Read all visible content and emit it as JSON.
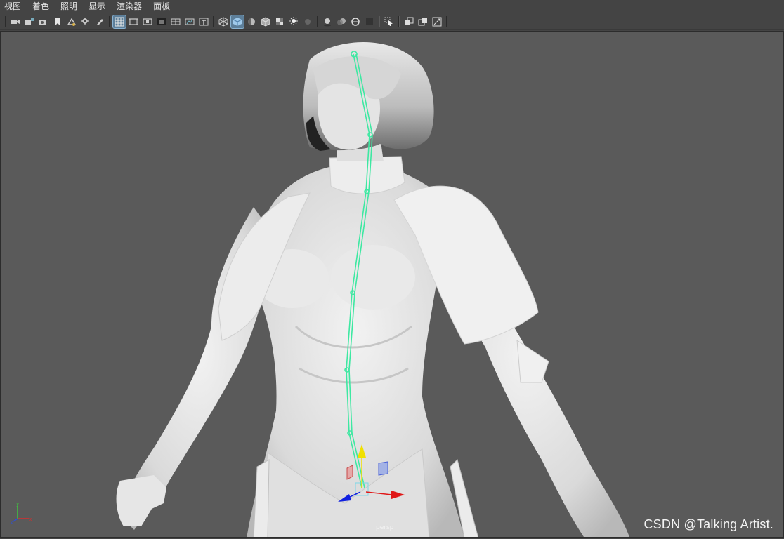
{
  "menubar": {
    "items": [
      "视图",
      "着色",
      "照明",
      "显示",
      "渲染器",
      "面板"
    ]
  },
  "toolbar": {
    "groups": [
      [
        "camera-icon",
        "camera-attributes-icon",
        "camera-lock-icon",
        "bookmark-icon",
        "image-plane-icon",
        "pan-zoom-icon",
        "grease-pencil-icon"
      ],
      [
        "grid-icon",
        "film-gate-icon",
        "resolution-gate-icon",
        "gate-mask-icon",
        "field-chart-icon",
        "safe-action-icon",
        "safe-title-icon"
      ],
      [
        "wireframe-icon",
        "smooth-shade-icon",
        "default-material-icon",
        "shaded-wireframe-icon",
        "textured-icon",
        "lights-icon",
        "shadows-icon"
      ],
      [
        "screen-space-ao-icon",
        "motion-blur-icon",
        "multisample-aa-icon",
        "depth-of-field-icon"
      ],
      [
        "isolate-select-icon"
      ],
      [
        "xray-icon",
        "xray-active-icon",
        "xray-joints-icon"
      ]
    ],
    "active": [
      "grid-icon",
      "smooth-shade-icon"
    ]
  },
  "viewport": {
    "camera_label": "persp",
    "watermark": "CSDN @Talking Artist.",
    "axis": {
      "x": "x",
      "y": "y",
      "z": "z"
    }
  },
  "colors": {
    "viewport_bg": "#5a5a5a",
    "model": "#e2e2e2",
    "joint_chain": "#3ee8a2",
    "manip_x": "#e01818",
    "manip_y": "#f0e000",
    "manip_z": "#1020e0"
  }
}
